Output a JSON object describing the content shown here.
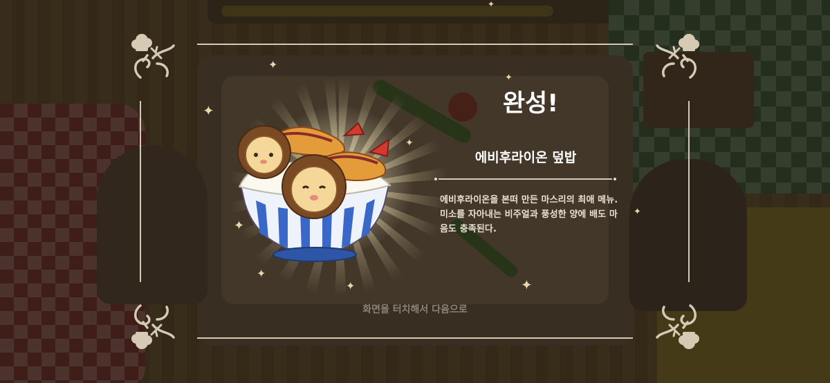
{
  "result": {
    "title": "완성!",
    "dish_name": "에비후라이온 덮밥",
    "description": "에비후라이온을 본떠 만든 마스리의 최애 메뉴. 미소를 자아내는 비주얼과 풍성한 양에 배도 마음도 충족된다."
  },
  "prompt": {
    "touch_to_continue": "화면을 터치해서 다음으로"
  },
  "colors": {
    "frame_line": "#d6cab4",
    "title_text": "#ffffff",
    "description_text": "#e8e1d3",
    "prompt_text": "#8a8478",
    "overlay": "rgba(28,22,14,0.64)"
  },
  "icons": {
    "corner": "chef-hat-and-utensils-ornament",
    "sparkle": "four-point-star",
    "dish": "lion-shrimp-tempura-rice-bowl"
  }
}
